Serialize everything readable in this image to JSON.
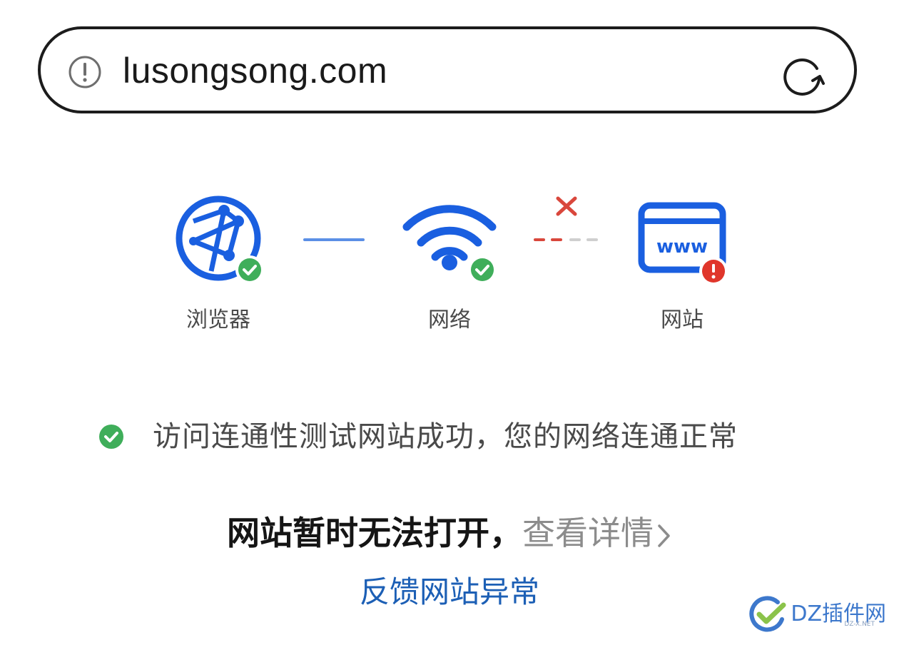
{
  "url_bar": {
    "url": "lusongsong.com",
    "warn_icon": "exclamation-circle-icon",
    "reload_icon": "reload-icon"
  },
  "diagnostics": {
    "nodes": [
      {
        "label": "浏览器",
        "icon": "globe-network-icon",
        "status": "ok"
      },
      {
        "label": "网络",
        "icon": "wifi-icon",
        "status": "ok"
      },
      {
        "label": "网站",
        "icon": "www-window-icon",
        "status": "error"
      }
    ],
    "colors": {
      "accent": "#1a5fe0",
      "ok": "#3fae5a",
      "error": "#e0362b"
    }
  },
  "status": {
    "message": "访问连通性测试网站成功，您的网络连通正常"
  },
  "main": {
    "headline": "网站暂时无法打开，",
    "detail_link": "查看详情",
    "feedback_link": "反馈网站异常"
  },
  "watermark": {
    "text": "DZ插件网",
    "sub": "DZ-X.NET"
  }
}
